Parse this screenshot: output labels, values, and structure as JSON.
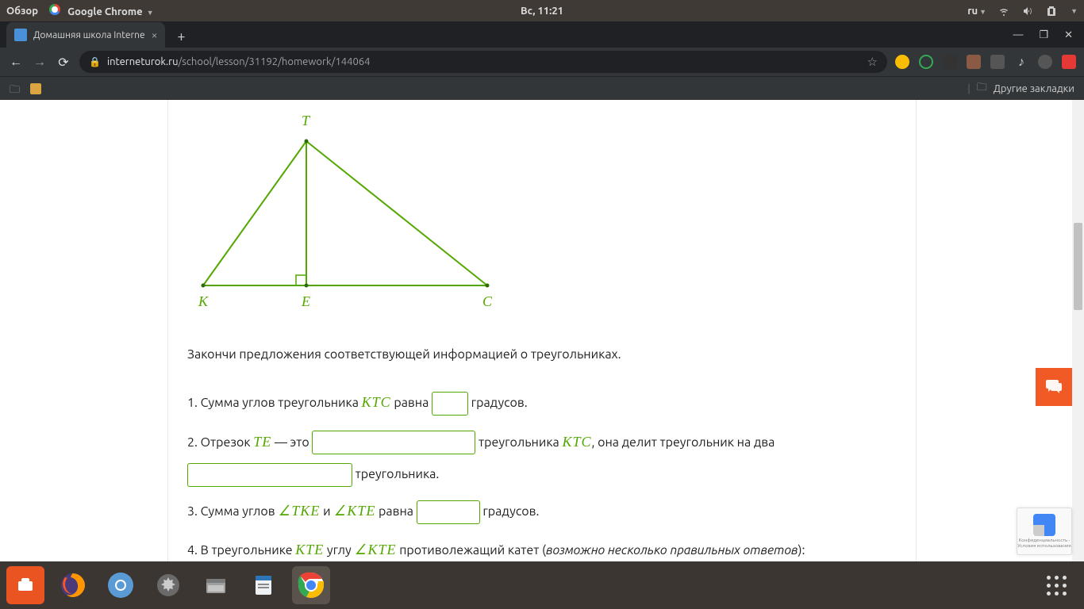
{
  "sysbar": {
    "overview": "Обзор",
    "app_name": "Google Chrome",
    "clock": "Вс, 11:21",
    "lang": "ru"
  },
  "tab": {
    "title": "Домашняя школа Interne",
    "close": "×"
  },
  "address": {
    "domain": "interneturok.ru",
    "path": "/school/lesson/31192/homework/144064"
  },
  "bookmarks": {
    "other": "Другие закладки"
  },
  "lesson": {
    "labels": {
      "T": "T",
      "K": "K",
      "E": "E",
      "C": "C"
    },
    "prompt": "Закончи предложения соответствующей информацией о треугольниках.",
    "q1a": "1. Сумма углов треугольника ",
    "q1_tri": "KTC",
    "q1b": " равна ",
    "q1c": " градусов.",
    "q2a": "2. Отрезок ",
    "q2_seg": "TE",
    "q2b": " — это ",
    "q2c": " треугольника ",
    "q2_tri": "KTC",
    "q2d": ", она делит треугольник на два",
    "q2e": " треугольника.",
    "q3a": "3. Сумма углов ",
    "q3_ang1": "TKE",
    "q3b": " и ",
    "q3_ang2": "KTE",
    "q3c": " равна ",
    "q3d": " градусов.",
    "q4a": "4. В треугольнике ",
    "q4_tri": "KTE",
    "q4b": " углу ",
    "q4_ang": "KTE",
    "q4c": " противолежащий катет (",
    "q4_note": "возможно несколько правильных ответов",
    "q4d": "):"
  },
  "recap": {
    "l1": "Конфиденциальность -",
    "l2": "Условия использования"
  }
}
